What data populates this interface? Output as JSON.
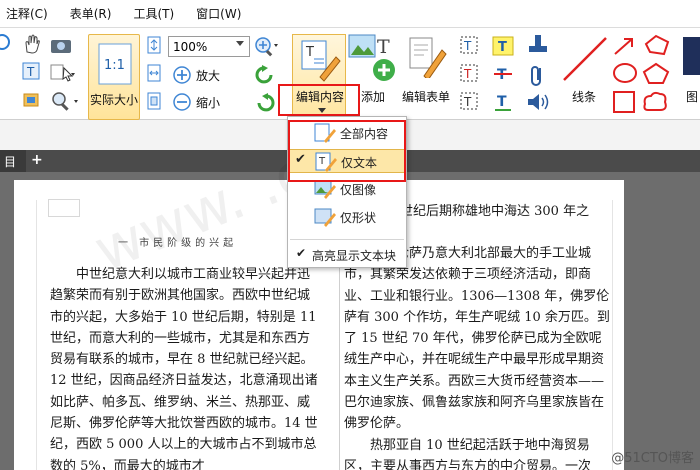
{
  "menu": [
    "注释(C)",
    "表单(R)",
    "工具(T)",
    "窗口(W)"
  ],
  "toolbar": {
    "zoom_value": "100%",
    "zoom_in": "放大",
    "zoom_out": "缩小",
    "actual_size": "实际大小",
    "actual_size_glyph": "1:1",
    "edit_content": "编辑内容",
    "add_label": "添加",
    "edit_form": "编辑表单",
    "line_label": "线条",
    "image_label": "图"
  },
  "tabs": {
    "current": "目",
    "add": "+"
  },
  "dropdown": {
    "items": [
      "全部内容",
      "仅文本",
      "仅图像",
      "仅形状"
    ],
    "selected_index": 1,
    "extra": "高亮显示文本块",
    "extra_checked": true
  },
  "document": {
    "header_left": "一 市民阶级的兴起",
    "right_top": "世纪后期称雄地中海达 300 年之",
    "left_paragraph": "中世纪意大利以城市工商业较早兴起并迅趋繁荣而有别于欧洲其他国家。西欧中世纪城市的兴起，大多始于 10 世纪后期，特别是 11 世纪，而意大利的一些城市，尤其是和东西方贸易有联系的城市，早在 8 世纪就已经兴起。12 世纪，因商品经济日益发达，北意涌现出诸如比萨、帕多瓦、维罗纳、米兰、热那亚、威尼斯、佛罗伦萨等大批饮誉西欧的城市。14 世纪，西欧 5 000 人以上的大城市占不到城市总数的 5%，而最大的城市才",
    "right_paragraph_1": "佛罗伦萨乃意大利北部最大的手工业城市，其繁荣发达依赖于三项经济活动，即商业、工业和银行业。1306—1308 年，佛罗伦萨有 300 个作坊，年生产呢绒 10 余万匹。到了 15 世纪 70 年代，佛罗伦萨已成为全欧呢绒生产中心，并在呢绒生产中最早形成早期资本主义生产关系。西欧三大货币经营资本——巴尔迪家族、佩鲁兹家族和阿齐乌里家族皆在佛罗伦萨。",
    "right_paragraph_2": "热那亚自 10 世纪起活跃于地中海贸易区，主要从事西方与东方的中介贸易。一次",
    "watermark": "www.         .com",
    "corner_watermark": "@51CTO博客"
  },
  "colors": {
    "highlight_red": "#e81818",
    "selected_bg": "#fde7a8",
    "tab_bg": "#4b4b4b"
  }
}
